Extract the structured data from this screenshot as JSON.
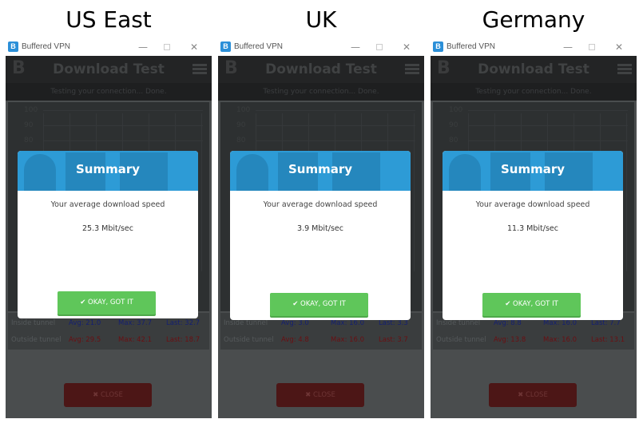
{
  "panels": [
    {
      "region": "US East",
      "window": {
        "app_title": "Buffered VPN",
        "app_icon_letter": "B",
        "minimize": "—",
        "close": "✕"
      },
      "header": {
        "logo": "B",
        "title": "Download Test"
      },
      "status": "Testing your connection... Done.",
      "chart": {
        "y_ticks": [
          "100",
          "90",
          "80"
        ]
      },
      "stats": {
        "inside": {
          "label": "Inside tunnel",
          "avg": "Avg: 21.0",
          "max": "Max: 37.7",
          "last": "Last: 32.7"
        },
        "outside": {
          "label": "Outside tunnel",
          "avg": "Avg: 29.5",
          "max": "Max: 42.1",
          "last": "Last: 18.7"
        }
      },
      "close_button": "✖  CLOSE",
      "modal": {
        "title": "Summary",
        "text": "Your average download speed",
        "value": "25.3 Mbit/sec",
        "ok_button": "✔  OKAY, GOT IT"
      }
    },
    {
      "region": "UK",
      "window": {
        "app_title": "Buffered VPN",
        "app_icon_letter": "B",
        "minimize": "—",
        "close": "✕"
      },
      "header": {
        "logo": "B",
        "title": "Download Test"
      },
      "status": "Testing your connection... Done.",
      "chart": {
        "y_ticks": [
          "100",
          "90",
          "80"
        ]
      },
      "stats": {
        "inside": {
          "label": "Inside tunnel",
          "avg": "Avg: 3.0",
          "max": "Max: 16.0",
          "last": "Last: 3.3"
        },
        "outside": {
          "label": "Outside tunnel",
          "avg": "Avg: 4.8",
          "max": "Max: 16.0",
          "last": "Last: 3.7"
        }
      },
      "close_button": "✖  CLOSE",
      "modal": {
        "title": "Summary",
        "text": "Your average download speed",
        "value": "3.9 Mbit/sec",
        "ok_button": "✔  OKAY, GOT IT"
      }
    },
    {
      "region": "Germany",
      "window": {
        "app_title": "Buffered VPN",
        "app_icon_letter": "B",
        "minimize": "—",
        "close": "✕"
      },
      "header": {
        "logo": "B",
        "title": "Download Test"
      },
      "status": "Testing your connection... Done.",
      "chart": {
        "y_ticks": [
          "100",
          "90",
          "80"
        ]
      },
      "stats": {
        "inside": {
          "label": "Inside tunnel",
          "avg": "Avg: 8.8",
          "max": "Max: 16.0",
          "last": "Last: 7.7"
        },
        "outside": {
          "label": "Outside tunnel",
          "avg": "Avg: 13.8",
          "max": "Max: 16.0",
          "last": "Last: 13.1"
        }
      },
      "close_button": "✖  CLOSE",
      "modal": {
        "title": "Summary",
        "text": "Your average download speed",
        "value": "11.3 Mbit/sec",
        "ok_button": "✔  OKAY, GOT IT"
      }
    }
  ],
  "colors": {
    "modal_header": "#2d9bd6",
    "ok_button": "#5fc65a",
    "close_button": "#4c1616",
    "inside_tunnel": "#152070",
    "outside_tunnel": "#6a0f12"
  }
}
